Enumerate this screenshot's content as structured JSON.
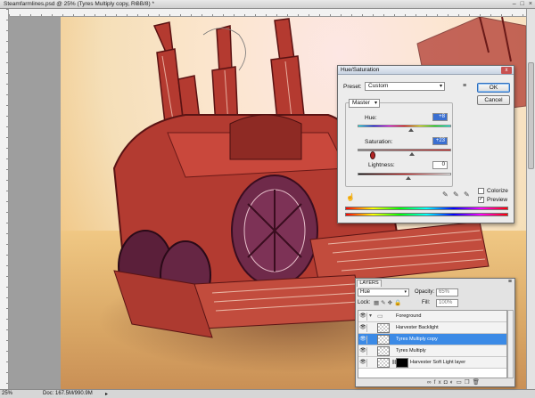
{
  "document": {
    "title": "Steamfarmlines.psd @ 25% (Tyres Multiply copy, RGB/8) *",
    "close_glyph": "×",
    "window_buttons": [
      "–",
      "□",
      "×"
    ]
  },
  "status": {
    "zoom": "25%",
    "doc_size": "Doc: 167.5M/990.9M",
    "arrow": "▸"
  },
  "hue_sat": {
    "title": "Hue/Saturation",
    "close_glyph": "x",
    "preset_label": "Preset:",
    "preset_value": "Custom",
    "preset_options_glyph": "≡",
    "ok_label": "OK",
    "cancel_label": "Cancel",
    "edit_value": "Master",
    "hue_label": "Hue:",
    "hue_value": "+8",
    "saturation_label": "Saturation:",
    "saturation_value": "+23",
    "lightness_label": "Lightness:",
    "lightness_value": "0",
    "colorize_label": "Colorize",
    "colorize_checked": false,
    "preview_label": "Preview",
    "preview_checked": true
  },
  "layers": {
    "tab_label": "LAYERS",
    "menu_glyph": "≡",
    "blend_mode": "Hue",
    "opacity_label": "Opacity:",
    "opacity_value": "65%",
    "lock_label": "Lock:",
    "fill_label": "Fill:",
    "fill_value": "100%",
    "items": [
      {
        "name": "Foreground",
        "type": "group"
      },
      {
        "name": "Harvester Backlight",
        "type": "layer"
      },
      {
        "name": "Tyres Multiply copy",
        "type": "layer",
        "selected": true
      },
      {
        "name": "Tyres Multiply",
        "type": "layer"
      },
      {
        "name": "Harvester Soft Light layer",
        "type": "masked"
      }
    ],
    "footer_icons": [
      "link-icon",
      "fx-icon",
      "mask-icon",
      "adjustment-icon",
      "group-icon",
      "new-layer-icon",
      "trash-icon"
    ]
  },
  "colors": {
    "accent": "#3b8ae6",
    "dialog_bg": "#ececec",
    "paint_red": "#b83a32"
  }
}
